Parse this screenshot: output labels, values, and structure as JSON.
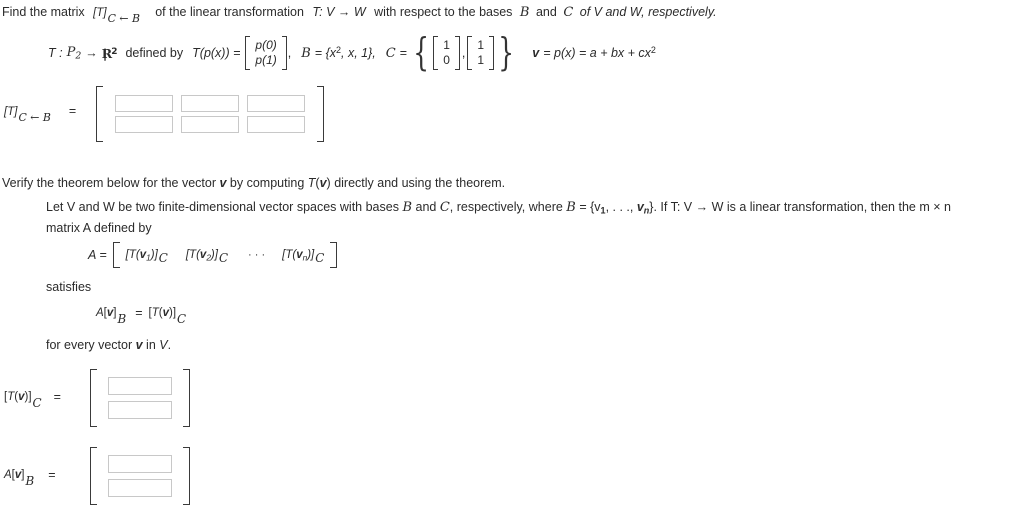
{
  "problem": {
    "prompt_part1": "Find the matrix",
    "prompt_matrix_sym": "[T]",
    "prompt_matrix_sub": "C ← B",
    "prompt_part2": "of the linear transformation",
    "prompt_transform": "T: V → W",
    "prompt_part3": "with respect to the bases",
    "prompt_basis_b": "B",
    "prompt_and": "and",
    "prompt_basis_c": "C",
    "prompt_part4": "of V and W, respectively."
  },
  "given": {
    "map_label": "T :",
    "domain": "P",
    "domain_sub": "2",
    "arrow": "→",
    "codomain": "R",
    "codomain_sup": "2",
    "defined_by": "defined by",
    "t_of_p": "T(p(x)) =",
    "tp_vector": [
      "p(0)",
      "p(1)"
    ],
    "comma1": ",",
    "basis_b_label": "B",
    "basis_b_eq": "= {x",
    "basis_b_sup": "2",
    "basis_b_rest": ", x, 1},",
    "basis_c_label": "C",
    "basis_c_eq": "=",
    "basis_c_vec1": [
      "1",
      "0"
    ],
    "basis_c_sep": ",",
    "basis_c_vec2": [
      "1",
      "1"
    ],
    "v_label": "v",
    "v_eq": "= p(x) = a + bx + cx",
    "v_sup": "2"
  },
  "answer1": {
    "label_sym": "[T]",
    "label_sub": "C ← B",
    "equals": "=",
    "rows": [
      [
        "",
        "",
        ""
      ],
      [
        "",
        "",
        ""
      ]
    ]
  },
  "verify": {
    "instruction_a": "Verify the theorem below for the vector",
    "instruction_v": "v",
    "instruction_b": "by computing",
    "instruction_tv": "T(v)",
    "instruction_c": "directly and using the theorem."
  },
  "theorem": {
    "line1_a": "Let V and W be two finite-dimensional vector spaces with bases",
    "line1_b": "B",
    "line1_c": "and",
    "line1_d": "C",
    "line1_e": ", respectively, where",
    "line1_f": "B",
    "line1_g": "= {v",
    "line1_h": "1",
    "line1_i": ", . . .,",
    "line1_j": "v",
    "line1_k": "n",
    "line1_l": "}. If T: V → W is a linear transformation, then the m × n",
    "line2": "matrix A defined by",
    "formula_a_label": "A =",
    "formula_cols": [
      "[T(v",
      "[T(v",
      "[T(v"
    ],
    "col1_sub": "1",
    "col2_sub": "2",
    "coln_sub": "n",
    "col_close": ")]",
    "col_basis": "C",
    "dots": "· · ·",
    "satisfies": "satisfies",
    "identity_left": "A[v]",
    "identity_left_sub": "B",
    "identity_eq": "=",
    "identity_right": "[T(v)]",
    "identity_right_sub": "C",
    "closing": "for every vector v in V."
  },
  "answer2": {
    "label_sym": "[T(v)]",
    "label_sub": "C",
    "equals": "=",
    "rows": [
      "",
      ""
    ]
  },
  "answer3": {
    "label_sym": "A[v]",
    "label_sub": "B",
    "equals": "=",
    "rows": [
      "",
      ""
    ]
  },
  "colors": {
    "text": "#2b2b2b",
    "bracket": "#3a3a3a",
    "input_border": "#c8c8c8",
    "background": "#ffffff"
  }
}
